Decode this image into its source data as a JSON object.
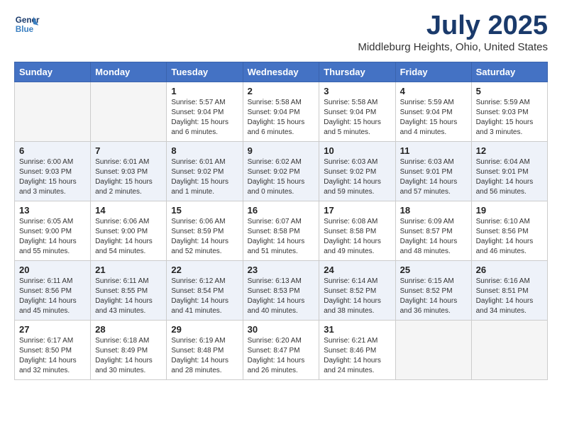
{
  "header": {
    "logo_line1": "General",
    "logo_line2": "Blue",
    "month": "July 2025",
    "location": "Middleburg Heights, Ohio, United States"
  },
  "weekdays": [
    "Sunday",
    "Monday",
    "Tuesday",
    "Wednesday",
    "Thursday",
    "Friday",
    "Saturday"
  ],
  "weeks": [
    [
      {
        "day": "",
        "info": ""
      },
      {
        "day": "",
        "info": ""
      },
      {
        "day": "1",
        "info": "Sunrise: 5:57 AM\nSunset: 9:04 PM\nDaylight: 15 hours\nand 6 minutes."
      },
      {
        "day": "2",
        "info": "Sunrise: 5:58 AM\nSunset: 9:04 PM\nDaylight: 15 hours\nand 6 minutes."
      },
      {
        "day": "3",
        "info": "Sunrise: 5:58 AM\nSunset: 9:04 PM\nDaylight: 15 hours\nand 5 minutes."
      },
      {
        "day": "4",
        "info": "Sunrise: 5:59 AM\nSunset: 9:04 PM\nDaylight: 15 hours\nand 4 minutes."
      },
      {
        "day": "5",
        "info": "Sunrise: 5:59 AM\nSunset: 9:03 PM\nDaylight: 15 hours\nand 3 minutes."
      }
    ],
    [
      {
        "day": "6",
        "info": "Sunrise: 6:00 AM\nSunset: 9:03 PM\nDaylight: 15 hours\nand 3 minutes."
      },
      {
        "day": "7",
        "info": "Sunrise: 6:01 AM\nSunset: 9:03 PM\nDaylight: 15 hours\nand 2 minutes."
      },
      {
        "day": "8",
        "info": "Sunrise: 6:01 AM\nSunset: 9:02 PM\nDaylight: 15 hours\nand 1 minute."
      },
      {
        "day": "9",
        "info": "Sunrise: 6:02 AM\nSunset: 9:02 PM\nDaylight: 15 hours\nand 0 minutes."
      },
      {
        "day": "10",
        "info": "Sunrise: 6:03 AM\nSunset: 9:02 PM\nDaylight: 14 hours\nand 59 minutes."
      },
      {
        "day": "11",
        "info": "Sunrise: 6:03 AM\nSunset: 9:01 PM\nDaylight: 14 hours\nand 57 minutes."
      },
      {
        "day": "12",
        "info": "Sunrise: 6:04 AM\nSunset: 9:01 PM\nDaylight: 14 hours\nand 56 minutes."
      }
    ],
    [
      {
        "day": "13",
        "info": "Sunrise: 6:05 AM\nSunset: 9:00 PM\nDaylight: 14 hours\nand 55 minutes."
      },
      {
        "day": "14",
        "info": "Sunrise: 6:06 AM\nSunset: 9:00 PM\nDaylight: 14 hours\nand 54 minutes."
      },
      {
        "day": "15",
        "info": "Sunrise: 6:06 AM\nSunset: 8:59 PM\nDaylight: 14 hours\nand 52 minutes."
      },
      {
        "day": "16",
        "info": "Sunrise: 6:07 AM\nSunset: 8:58 PM\nDaylight: 14 hours\nand 51 minutes."
      },
      {
        "day": "17",
        "info": "Sunrise: 6:08 AM\nSunset: 8:58 PM\nDaylight: 14 hours\nand 49 minutes."
      },
      {
        "day": "18",
        "info": "Sunrise: 6:09 AM\nSunset: 8:57 PM\nDaylight: 14 hours\nand 48 minutes."
      },
      {
        "day": "19",
        "info": "Sunrise: 6:10 AM\nSunset: 8:56 PM\nDaylight: 14 hours\nand 46 minutes."
      }
    ],
    [
      {
        "day": "20",
        "info": "Sunrise: 6:11 AM\nSunset: 8:56 PM\nDaylight: 14 hours\nand 45 minutes."
      },
      {
        "day": "21",
        "info": "Sunrise: 6:11 AM\nSunset: 8:55 PM\nDaylight: 14 hours\nand 43 minutes."
      },
      {
        "day": "22",
        "info": "Sunrise: 6:12 AM\nSunset: 8:54 PM\nDaylight: 14 hours\nand 41 minutes."
      },
      {
        "day": "23",
        "info": "Sunrise: 6:13 AM\nSunset: 8:53 PM\nDaylight: 14 hours\nand 40 minutes."
      },
      {
        "day": "24",
        "info": "Sunrise: 6:14 AM\nSunset: 8:52 PM\nDaylight: 14 hours\nand 38 minutes."
      },
      {
        "day": "25",
        "info": "Sunrise: 6:15 AM\nSunset: 8:52 PM\nDaylight: 14 hours\nand 36 minutes."
      },
      {
        "day": "26",
        "info": "Sunrise: 6:16 AM\nSunset: 8:51 PM\nDaylight: 14 hours\nand 34 minutes."
      }
    ],
    [
      {
        "day": "27",
        "info": "Sunrise: 6:17 AM\nSunset: 8:50 PM\nDaylight: 14 hours\nand 32 minutes."
      },
      {
        "day": "28",
        "info": "Sunrise: 6:18 AM\nSunset: 8:49 PM\nDaylight: 14 hours\nand 30 minutes."
      },
      {
        "day": "29",
        "info": "Sunrise: 6:19 AM\nSunset: 8:48 PM\nDaylight: 14 hours\nand 28 minutes."
      },
      {
        "day": "30",
        "info": "Sunrise: 6:20 AM\nSunset: 8:47 PM\nDaylight: 14 hours\nand 26 minutes."
      },
      {
        "day": "31",
        "info": "Sunrise: 6:21 AM\nSunset: 8:46 PM\nDaylight: 14 hours\nand 24 minutes."
      },
      {
        "day": "",
        "info": ""
      },
      {
        "day": "",
        "info": ""
      }
    ]
  ]
}
